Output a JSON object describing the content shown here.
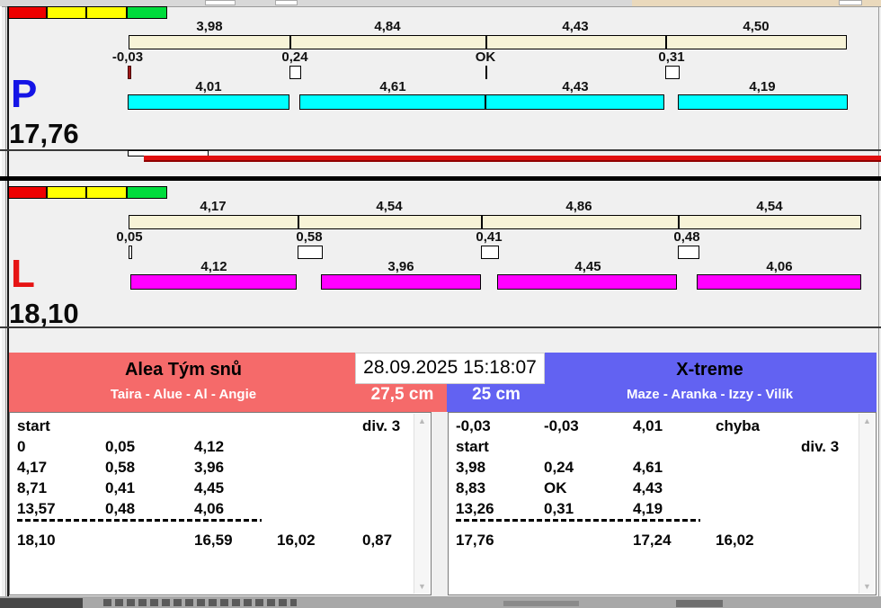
{
  "window": {
    "datetime": "28.09.2025 15:18:07"
  },
  "status_lights": {
    "colors": [
      "#ee0000",
      "#ffff00",
      "#ffff00",
      "#00dc3c"
    ]
  },
  "lanes": [
    {
      "letter": "P",
      "letter_color": "#1414e6",
      "total": "17,76",
      "bar_color": "#00ffff",
      "splits": [
        {
          "label": "3,98",
          "end": 3.98
        },
        {
          "label": "4,84",
          "end": 8.83
        },
        {
          "label": "4,43",
          "end": 13.26
        },
        {
          "label": "4,50",
          "end": 17.76
        }
      ],
      "changeovers": [
        {
          "label": "-0,03",
          "t": -0.03,
          "dt": 0.03,
          "type": "fault"
        },
        {
          "label": "0,24",
          "t": 3.98,
          "dt": 0.24,
          "type": "box"
        },
        {
          "label": "OK",
          "t": 8.83,
          "dt": 0,
          "type": "ok"
        },
        {
          "label": "0,31",
          "t": 13.26,
          "dt": 0.31,
          "type": "box"
        }
      ],
      "runs": [
        {
          "label": "4,01",
          "start": -0.03,
          "end": 3.98
        },
        {
          "label": "4,61",
          "start": 4.22,
          "end": 8.83
        },
        {
          "label": "4,43",
          "start": 8.83,
          "end": 13.26
        },
        {
          "label": "4,19",
          "start": 13.57,
          "end": 17.76
        }
      ]
    },
    {
      "letter": "L",
      "letter_color": "#e61414",
      "total": "18,10",
      "bar_color": "#ff00ff",
      "splits": [
        {
          "label": "4,17",
          "end": 4.17
        },
        {
          "label": "4,54",
          "end": 8.71
        },
        {
          "label": "4,86",
          "end": 13.57
        },
        {
          "label": "4,54",
          "end": 18.11
        }
      ],
      "changeovers": [
        {
          "label": "0,05",
          "t": 0,
          "dt": 0.05,
          "type": "box"
        },
        {
          "label": "0,58",
          "t": 4.17,
          "dt": 0.58,
          "type": "box"
        },
        {
          "label": "0,41",
          "t": 8.71,
          "dt": 0.41,
          "type": "box"
        },
        {
          "label": "0,48",
          "t": 13.57,
          "dt": 0.48,
          "type": "box"
        }
      ],
      "runs": [
        {
          "label": "4,12",
          "start": 0.05,
          "end": 4.17
        },
        {
          "label": "3,96",
          "start": 4.75,
          "end": 8.71
        },
        {
          "label": "4,45",
          "start": 9.12,
          "end": 13.57
        },
        {
          "label": "4,06",
          "start": 14.05,
          "end": 18.11
        }
      ]
    }
  ],
  "teams": [
    {
      "name": "Alea Tým snů",
      "dogs": "Taira - Alue - Al - Angie",
      "height": "27,5 cm",
      "accent": "#f56a6a",
      "rows": [
        [
          "start",
          "",
          "",
          "",
          "div.  3"
        ],
        [
          "0",
          "0,05",
          "4,12",
          "",
          ""
        ],
        [
          "4,17",
          "0,58",
          "3,96",
          "",
          ""
        ],
        [
          "8,71",
          "0,41",
          "4,45",
          "",
          ""
        ],
        [
          "13,57",
          "0,48",
          "4,06",
          "",
          ""
        ]
      ],
      "totals": [
        "18,10",
        "",
        "16,59",
        "16,02",
        "0,87"
      ]
    },
    {
      "name": "X-treme",
      "dogs": "Maze - Aranka - Izzy - Vilík",
      "height": "25 cm",
      "accent": "#6262f2",
      "rows": [
        [
          "-0,03",
          "-0,03",
          "4,01",
          "chyba",
          ""
        ],
        [
          "start",
          "",
          "",
          "",
          "div.  3"
        ],
        [
          "3,98",
          "0,24",
          "4,61",
          "",
          ""
        ],
        [
          "8,83",
          "OK",
          "4,43",
          "",
          ""
        ],
        [
          "13,26",
          "0,31",
          "4,19",
          "",
          ""
        ]
      ],
      "totals": [
        "17,76",
        "",
        "17,24",
        "16,02",
        ""
      ]
    }
  ]
}
